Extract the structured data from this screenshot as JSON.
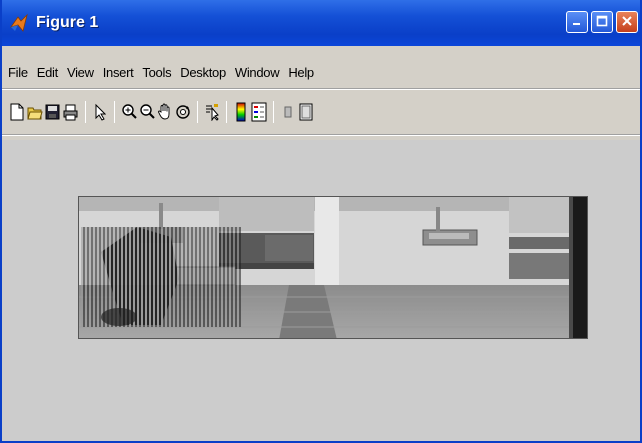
{
  "window": {
    "title": "Figure 1"
  },
  "title_buttons": {
    "minimize_icon": "minimize-icon",
    "maximize_icon": "maximize-icon",
    "close_icon": "close-icon"
  },
  "menu": {
    "items": [
      "File",
      "Edit",
      "View",
      "Insert",
      "Tools",
      "Desktop",
      "Window",
      "Help"
    ]
  },
  "toolbar": {
    "icons": [
      "new-figure-icon",
      "open-file-icon",
      "save-icon",
      "print-icon",
      "edit-plot-arrow-icon",
      "zoom-in-icon",
      "zoom-out-icon",
      "pan-hand-icon",
      "rotate-3d-icon",
      "data-cursor-icon",
      "insert-colorbar-icon",
      "insert-legend-icon",
      "hide-plot-tools-icon",
      "show-plot-tools-icon"
    ]
  },
  "colors": {
    "titlebar": "#0a3fc8",
    "window_bg": "#d4d0c8",
    "figure_bg": "#cccccc"
  }
}
